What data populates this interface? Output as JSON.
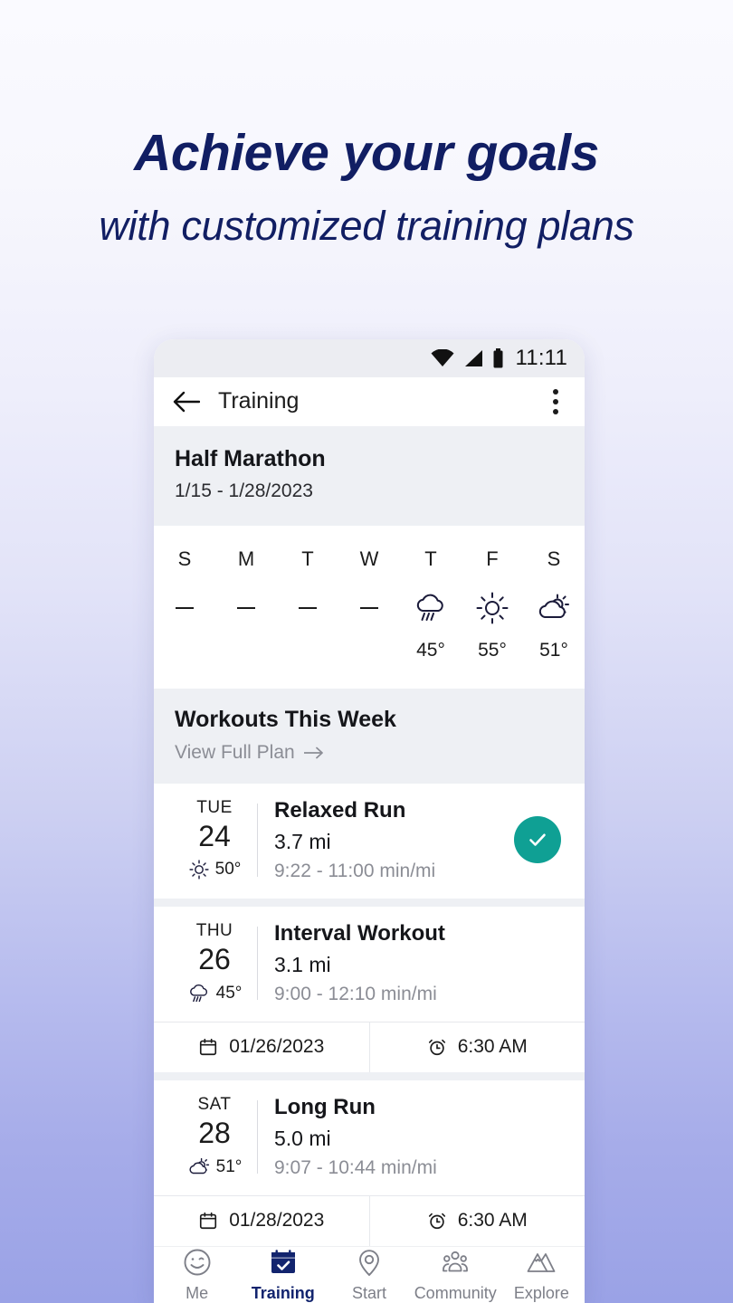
{
  "promo": {
    "title": "Achieve your goals",
    "subtitle": "with customized training plans",
    "title_color": "#111e63"
  },
  "statusbar": {
    "time": "11:11",
    "icons": [
      "wifi-icon",
      "cell-signal-icon",
      "battery-icon"
    ]
  },
  "appbar": {
    "back_label": "back-arrow",
    "title": "Training",
    "overflow_label": "more-options"
  },
  "plan": {
    "name": "Half Marathon",
    "dates": "1/15 - 1/28/2023"
  },
  "week": [
    {
      "letter": "S",
      "icon": "dash",
      "temp": ""
    },
    {
      "letter": "M",
      "icon": "dash",
      "temp": ""
    },
    {
      "letter": "T",
      "icon": "dash",
      "temp": ""
    },
    {
      "letter": "W",
      "icon": "dash",
      "temp": ""
    },
    {
      "letter": "T",
      "icon": "rain-icon",
      "temp": "45°"
    },
    {
      "letter": "F",
      "icon": "sun-icon",
      "temp": "55°"
    },
    {
      "letter": "S",
      "icon": "partly-cloudy-icon",
      "temp": "51°"
    }
  ],
  "workouts_section": {
    "title": "Workouts This Week",
    "link": "View Full Plan"
  },
  "workouts": [
    {
      "dow": "TUE",
      "day": "24",
      "weather_icon": "sun-icon",
      "temp": "50°",
      "title": "Relaxed Run",
      "distance": "3.7 mi",
      "pace": "9:22 - 11:00 min/mi",
      "completed": true,
      "check_color": "#0fa094",
      "footer": null
    },
    {
      "dow": "THU",
      "day": "26",
      "weather_icon": "rain-icon",
      "temp": "45°",
      "title": "Interval Workout",
      "distance": "3.1 mi",
      "pace": "9:00 - 12:10 min/mi",
      "completed": false,
      "footer": {
        "date": "01/26/2023",
        "time": "6:30 AM"
      }
    },
    {
      "dow": "SAT",
      "day": "28",
      "weather_icon": "partly-cloudy-icon",
      "temp": "51°",
      "title": "Long Run",
      "distance": "5.0 mi",
      "pace": "9:07 - 10:44 min/mi",
      "completed": false,
      "footer": {
        "date": "01/28/2023",
        "time": "6:30 AM"
      }
    }
  ],
  "bottom_nav": {
    "active_color": "#12246e",
    "items": [
      {
        "label": "Me",
        "icon": "smiley-icon",
        "active": false
      },
      {
        "label": "Training",
        "icon": "calendar-check-icon",
        "active": true
      },
      {
        "label": "Start",
        "icon": "location-pin-icon",
        "active": false
      },
      {
        "label": "Community",
        "icon": "people-icon",
        "active": false
      },
      {
        "label": "Explore",
        "icon": "mountains-icon",
        "active": false
      }
    ]
  }
}
